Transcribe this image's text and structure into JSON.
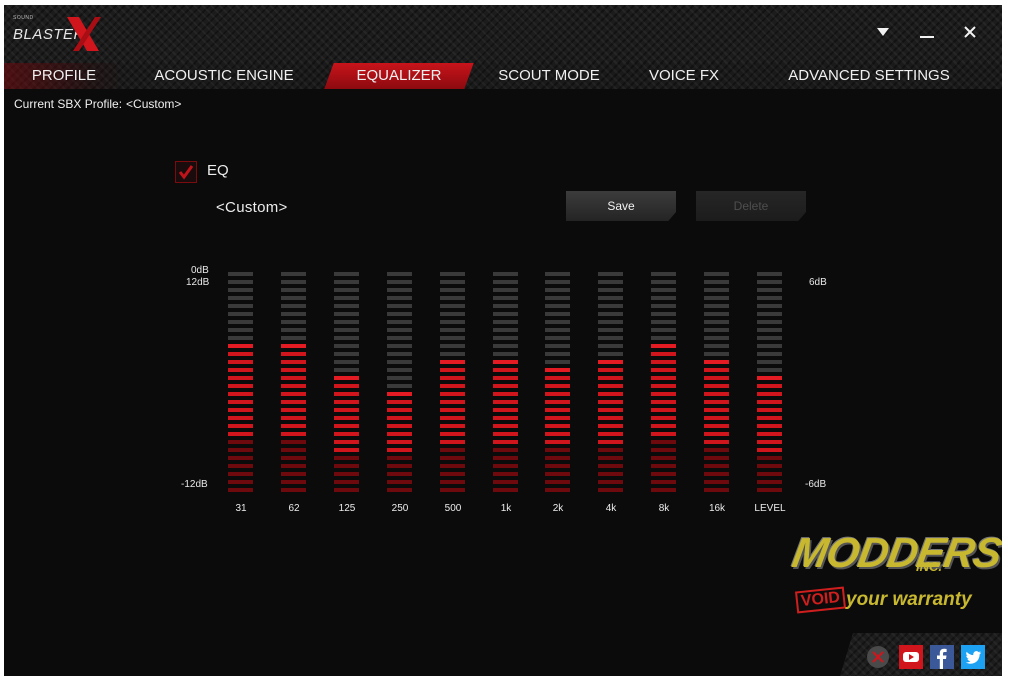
{
  "app": {
    "logo_small": "SOUND",
    "logo_word": "BLASTER",
    "logo_mark": "X",
    "window_controls": [
      "chevron-down-icon",
      "minimize-icon",
      "close-icon"
    ]
  },
  "tabs": [
    {
      "label": "PROFILE",
      "active": false
    },
    {
      "label": "ACOUSTIC ENGINE",
      "active": false
    },
    {
      "label": "EQUALIZER",
      "active": true
    },
    {
      "label": "SCOUT MODE",
      "active": false
    },
    {
      "label": "VOICE FX",
      "active": false
    },
    {
      "label": "ADVANCED SETTINGS",
      "active": false
    }
  ],
  "profile": {
    "label": "Current SBX Profile:",
    "value": "<Custom>"
  },
  "eq": {
    "enabled": true,
    "checkbox_label": "EQ",
    "preset": "<Custom>",
    "save_label": "Save",
    "delete_label": "Delete",
    "delete_enabled": false,
    "axis_left": {
      "top_a": "0dB",
      "top_b": "12dB",
      "bottom": "-12dB"
    },
    "axis_right": {
      "top": "6dB",
      "bottom": "-6dB"
    },
    "total_segments": 28,
    "bands": [
      {
        "label": "31",
        "lit": 19
      },
      {
        "label": "62",
        "lit": 19
      },
      {
        "label": "125",
        "lit": 15
      },
      {
        "label": "250",
        "lit": 13
      },
      {
        "label": "500",
        "lit": 17
      },
      {
        "label": "1k",
        "lit": 17
      },
      {
        "label": "2k",
        "lit": 16
      },
      {
        "label": "4k",
        "lit": 17
      },
      {
        "label": "8k",
        "lit": 19
      },
      {
        "label": "16k",
        "lit": 17
      },
      {
        "label": "LEVEL",
        "lit": 15
      }
    ],
    "colors": {
      "lit": "#d0151c",
      "lit_dim": "#6e0a0e",
      "off": "#3a3a3a"
    }
  },
  "watermark": {
    "brand": "MODDERS",
    "suffix": "INC.",
    "void": "VOID",
    "tagline": "your warranty"
  },
  "footer": {
    "icons": [
      "close-circle-icon",
      "youtube-icon",
      "facebook-icon",
      "twitter-icon"
    ]
  }
}
